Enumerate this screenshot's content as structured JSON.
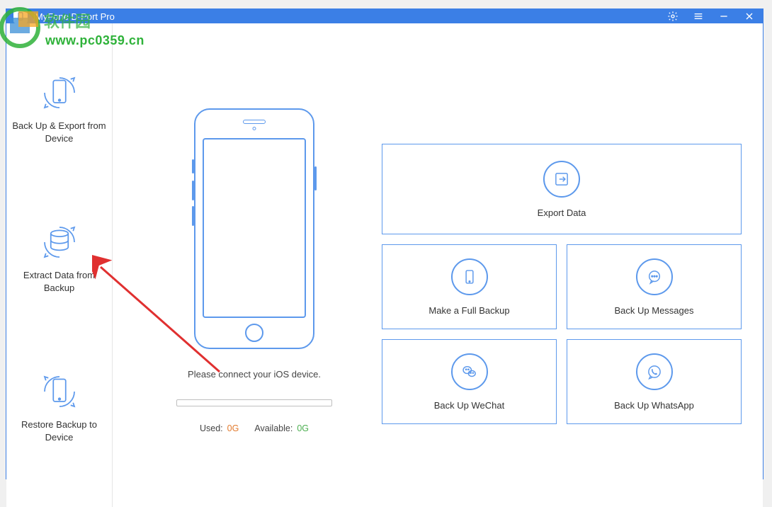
{
  "window": {
    "title": "iMyFone D-Port Pro"
  },
  "watermark": {
    "url": "www.pc0359.cn"
  },
  "sidebar": {
    "items": [
      {
        "label": "Back Up & Export from Device"
      },
      {
        "label": "Extract Data from Backup"
      },
      {
        "label": "Restore Backup to Device"
      }
    ]
  },
  "phone": {
    "connect_prompt": "Please connect your iOS device.",
    "used_label": "Used:",
    "used_value": "0G",
    "available_label": "Available:",
    "available_value": "0G"
  },
  "actions": {
    "export": "Export Data",
    "full_backup": "Make a Full Backup",
    "messages": "Back Up Messages",
    "wechat": "Back Up WeChat",
    "whatsapp": "Back Up WhatsApp"
  }
}
